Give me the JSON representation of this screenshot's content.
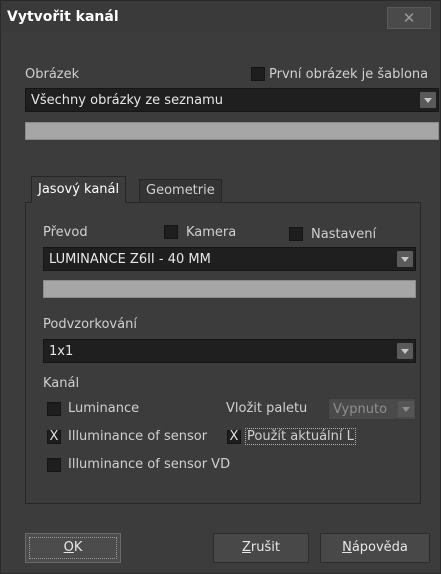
{
  "dialog": {
    "title": "Vytvořit kanál",
    "close_label": "✕"
  },
  "image_section": {
    "label": "Obrázek",
    "first_image_template": {
      "label": "První obrázek je šablona",
      "checked": false
    },
    "source_select": {
      "value": "Všechny obrázky ze seznamu"
    }
  },
  "tabs": [
    {
      "label": "Jasový kanál",
      "active": true
    },
    {
      "label": "Geometrie",
      "active": false
    }
  ],
  "conversion": {
    "label": "Převod",
    "camera": {
      "label": "Kamera",
      "checked": false
    },
    "settings": {
      "label": "Nastavení",
      "checked": false
    },
    "select": {
      "value": "LUMINANCE Z6II - 40 MM"
    }
  },
  "subsampling": {
    "label": "Podvzorkování",
    "select": {
      "value": "1x1"
    }
  },
  "channel": {
    "label": "Kanál",
    "luminance": {
      "label": "Luminance",
      "checked": false,
      "mark": ""
    },
    "illuminance_sensor": {
      "label": "Illuminance of sensor",
      "checked": true,
      "mark": "X"
    },
    "illuminance_sensor_vd": {
      "label": "Illuminance of sensor VD",
      "checked": false,
      "mark": ""
    },
    "insert_palette": {
      "label": "Vložit paletu",
      "value": "Vypnuto"
    },
    "use_current": {
      "label": "Použít aktuální L",
      "checked": true,
      "mark": "X"
    }
  },
  "buttons": {
    "ok": {
      "accel": "O",
      "rest": "K"
    },
    "cancel": {
      "accel": "Z",
      "rest": "rušit"
    },
    "help": {
      "accel": "N",
      "rest": "ápověda"
    }
  }
}
